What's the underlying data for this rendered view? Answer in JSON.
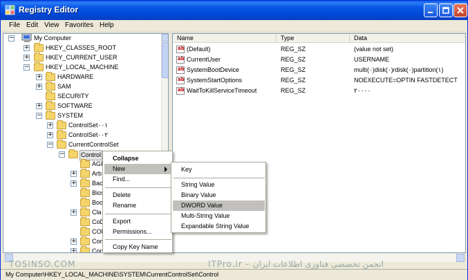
{
  "window": {
    "title": "Registry Editor"
  },
  "menubar": [
    "File",
    "Edit",
    "View",
    "Favorites",
    "Help"
  ],
  "tree": {
    "root": "My Computer",
    "nodes": [
      {
        "label": "HKEY_CLASSES_ROOT",
        "expander": "+"
      },
      {
        "label": "HKEY_CURRENT_USER",
        "expander": "+"
      },
      {
        "label": "HKEY_LOCAL_MACHINE",
        "expander": "−"
      },
      {
        "label": "HARDWARE",
        "expander": "+"
      },
      {
        "label": "SAM",
        "expander": "+"
      },
      {
        "label": "SECURITY",
        "expander": ""
      },
      {
        "label": "SOFTWARE",
        "expander": "+"
      },
      {
        "label": "SYSTEM",
        "expander": "−"
      },
      {
        "label": "ControlSet٠٠١",
        "expander": "+"
      },
      {
        "label": "ControlSet٠٠٢",
        "expander": "+"
      },
      {
        "label": "CurrentControlSet",
        "expander": "−"
      },
      {
        "label": "Control",
        "expander": "−"
      },
      {
        "label": "AGP",
        "expander": ""
      },
      {
        "label": "Arb",
        "expander": "+"
      },
      {
        "label": "Bac",
        "expander": "+"
      },
      {
        "label": "Bios",
        "expander": ""
      },
      {
        "label": "Boo",
        "expander": ""
      },
      {
        "label": "Cla",
        "expander": "+"
      },
      {
        "label": "CoD",
        "expander": ""
      },
      {
        "label": "COM",
        "expander": ""
      },
      {
        "label": "Com",
        "expander": "+"
      },
      {
        "label": "Con",
        "expander": "+"
      }
    ]
  },
  "list": {
    "columns": [
      "Name",
      "Type",
      "Data"
    ],
    "rows": [
      {
        "name": "(Default)",
        "type": "REG_SZ",
        "data": "(value not set)"
      },
      {
        "name": "CurrentUser",
        "type": "REG_SZ",
        "data": "USERNAME"
      },
      {
        "name": "SystemBootDevice",
        "type": "REG_SZ",
        "data": "multi(٠)disk(٠)rdisk(٠)partition(١)"
      },
      {
        "name": "SystemStartOptions",
        "type": "REG_SZ",
        "data": "NOEXECUTE=OPTIN FASTDETECT"
      },
      {
        "name": "WaitToKillServiceTimeout",
        "type": "REG_SZ",
        "data": "٢٠٠٠٠"
      }
    ],
    "value_icon": "ab"
  },
  "context_menu": {
    "items": [
      "Collapse",
      "New",
      "Find...",
      "Delete",
      "Rename",
      "Export",
      "Permissions...",
      "Copy Key Name"
    ]
  },
  "submenu": {
    "items": [
      "Key",
      "String Value",
      "Binary Value",
      "DWORD Value",
      "Multi-String Value",
      "Expandable String Value"
    ],
    "highlighted": "DWORD Value"
  },
  "status": "My Computer\\HKEY_LOCAL_MACHINE\\SYSTEM\\CurrentControlSet\\Control",
  "watermark": {
    "left": "TOSINSO.COM",
    "right": "ITPro.ir - انجمن تخصصی فناوری اطلاعات ایران"
  },
  "colors": {
    "titlebar": "#0A5BE8",
    "highlight": "#C1C0BC",
    "folder": "#F5D56B"
  }
}
